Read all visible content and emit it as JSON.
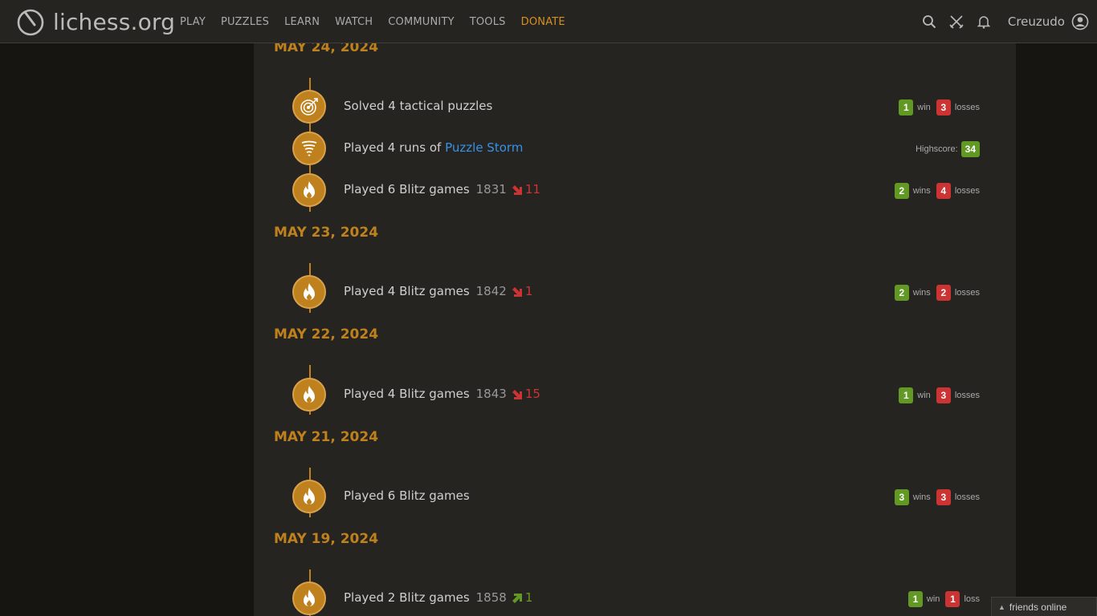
{
  "header": {
    "logo_text": "lichess.org",
    "nav": [
      "PLAY",
      "PUZZLES",
      "LEARN",
      "WATCH",
      "COMMUNITY",
      "TOOLS",
      "DONATE"
    ],
    "user": "Creuzudo"
  },
  "colors": {
    "accent": "#bf811d",
    "link": "#3692e7",
    "win": "#629924",
    "loss": "#cc3333"
  },
  "days": [
    {
      "date": "MAY 24, 2024",
      "entries": [
        {
          "icon": "puzzle-target-icon",
          "text": "Solved 4 tactical puzzles",
          "wins": "1",
          "win_word": "win",
          "losses": "3",
          "loss_word": "losses"
        },
        {
          "icon": "tornado-icon",
          "text": "Played 4 runs of ",
          "link": "Puzzle Storm",
          "highscore_label": "Highscore:",
          "highscore": "34"
        },
        {
          "icon": "flame-icon",
          "text": "Played 6 Blitz games",
          "rating": "1831",
          "delta": "11",
          "direction": "down",
          "wins": "2",
          "win_word": "wins",
          "losses": "4",
          "loss_word": "losses"
        }
      ]
    },
    {
      "date": "MAY 23, 2024",
      "entries": [
        {
          "icon": "flame-icon",
          "text": "Played 4 Blitz games",
          "rating": "1842",
          "delta": "1",
          "direction": "down",
          "wins": "2",
          "win_word": "wins",
          "losses": "2",
          "loss_word": "losses"
        }
      ]
    },
    {
      "date": "MAY 22, 2024",
      "entries": [
        {
          "icon": "flame-icon",
          "text": "Played 4 Blitz games",
          "rating": "1843",
          "delta": "15",
          "direction": "down",
          "wins": "1",
          "win_word": "win",
          "losses": "3",
          "loss_word": "losses"
        }
      ]
    },
    {
      "date": "MAY 21, 2024",
      "entries": [
        {
          "icon": "flame-icon",
          "text": "Played 6 Blitz games",
          "wins": "3",
          "win_word": "wins",
          "losses": "3",
          "loss_word": "losses"
        }
      ]
    },
    {
      "date": "MAY 19, 2024",
      "entries": [
        {
          "icon": "flame-icon",
          "text": "Played 2 Blitz games",
          "rating": "1858",
          "delta": "1",
          "direction": "up",
          "wins": "1",
          "win_word": "win",
          "losses": "1",
          "loss_word": "loss"
        }
      ]
    }
  ],
  "friends_label": "friends online"
}
